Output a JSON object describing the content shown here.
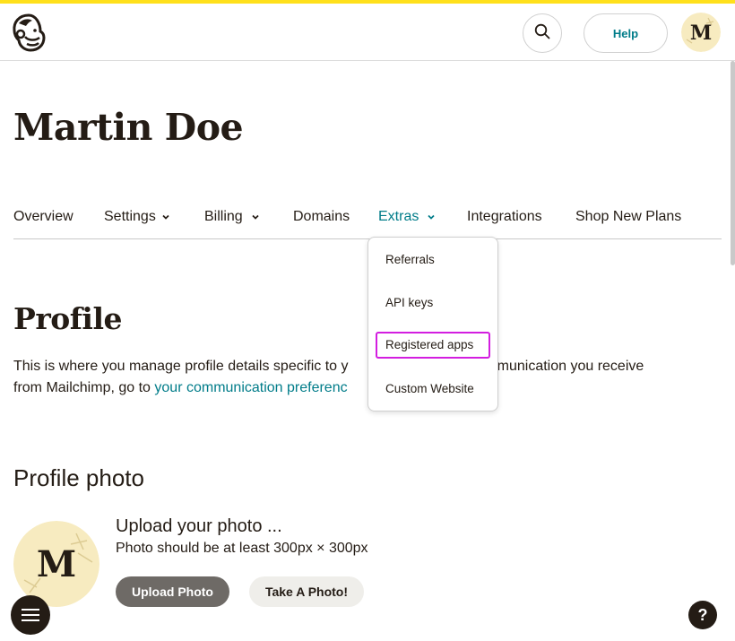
{
  "header": {
    "help_label": "Help",
    "avatar_letter": "M",
    "icons": {
      "logo": "mailchimp-logo-icon",
      "search": "search-icon"
    }
  },
  "page": {
    "title": "Martin Doe"
  },
  "nav": {
    "items": [
      {
        "label": "Overview",
        "has_chevron": false,
        "active": false
      },
      {
        "label": "Settings",
        "has_chevron": true,
        "active": false
      },
      {
        "label": "Billing",
        "has_chevron": true,
        "active": false
      },
      {
        "label": "Domains",
        "has_chevron": false,
        "active": false
      },
      {
        "label": "Extras",
        "has_chevron": true,
        "active": true
      },
      {
        "label": "Integrations",
        "has_chevron": false,
        "active": false
      },
      {
        "label": "Shop New Plans",
        "has_chevron": false,
        "active": false
      }
    ]
  },
  "dropdown": {
    "items": [
      {
        "label": "Referrals",
        "highlighted": false
      },
      {
        "label": "API keys",
        "highlighted": false
      },
      {
        "label": "Registered apps",
        "highlighted": true
      },
      {
        "label": "Custom Website",
        "highlighted": false
      }
    ]
  },
  "profile": {
    "heading": "Profile",
    "desc_line1": "This is where you manage profile details specific to y",
    "desc_line1_end": "t communication you receive",
    "desc_line2": "from Mailchimp, go to ",
    "desc_link": "your communication preferenc"
  },
  "photo": {
    "heading": "Profile photo",
    "avatar_letter": "M",
    "upload_title": "Upload your photo ...",
    "upload_sub": "Photo should be at least 300px × 300px",
    "upload_button": "Upload Photo",
    "take_button": "Take A Photo!"
  },
  "footer": {
    "help_button": "?",
    "menu_icon": "hamburger-menu-icon"
  },
  "colors": {
    "accent": "#007c89",
    "brand_yellow": "#ffe01b",
    "dark": "#241c15",
    "highlight": "#d31ee0"
  }
}
